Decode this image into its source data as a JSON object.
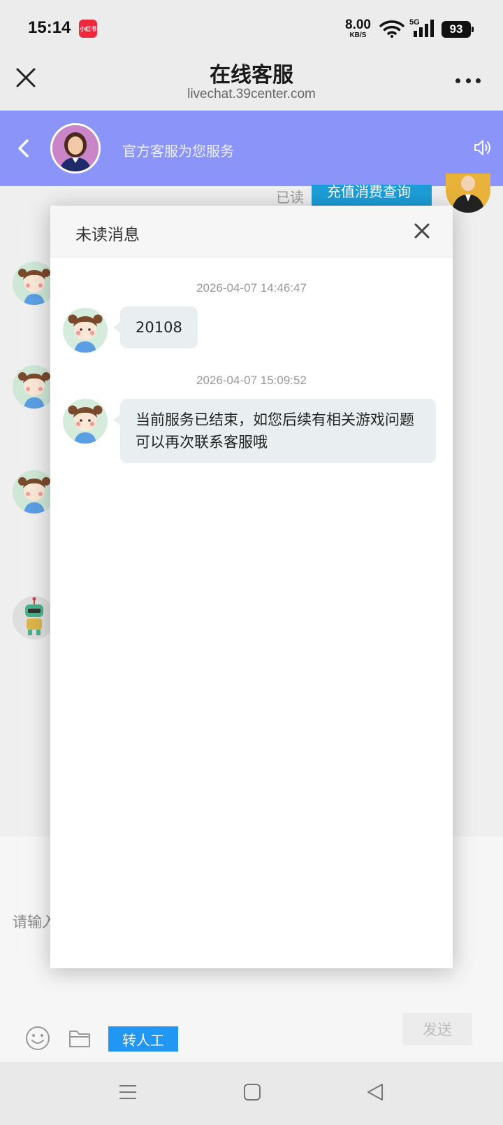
{
  "status_bar": {
    "time": "15:14",
    "app_badge": "小红书",
    "net_speed": "8.00",
    "net_unit": "KB/S",
    "network_type": "5G",
    "battery": "93"
  },
  "browser": {
    "title": "在线客服",
    "url": "livechat.39center.com"
  },
  "chat_header": {
    "service_text": "官方客服为您服务",
    "accent_color": "#8b94f9"
  },
  "background_chat": {
    "read_status": "已读",
    "user_message_partial": "充值消费查询",
    "input_placeholder": "请输入",
    "human_button": "转人工",
    "send_button": "发送"
  },
  "modal": {
    "title": "未读消息",
    "messages": [
      {
        "time": "2026-04-07 14:46:47",
        "text": "20108"
      },
      {
        "time": "2026-04-07 15:09:52",
        "text": "当前服务已结束，如您后续有相关游戏问题可以再次联系客服哦"
      }
    ]
  }
}
